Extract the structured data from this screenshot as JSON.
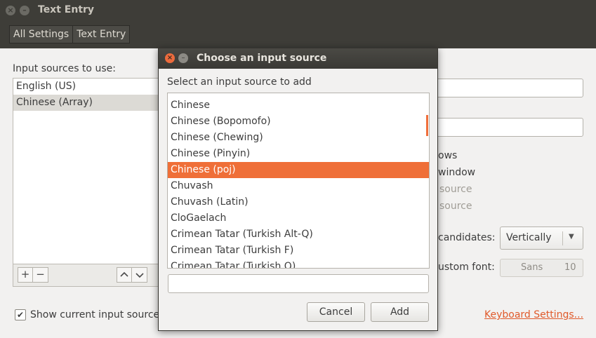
{
  "window": {
    "title": "Text Entry",
    "breadcrumbs": [
      "All Settings",
      "Text Entry"
    ]
  },
  "left_panel": {
    "heading": "Input sources to use:",
    "sources": [
      {
        "label": "English (US)",
        "selected": false
      },
      {
        "label": "Chinese (Array)",
        "selected": true
      }
    ],
    "add_label": "+",
    "remove_label": "−",
    "up_label": "⌃",
    "down_label": "⌄",
    "show_checkbox": {
      "checked": true,
      "label": "Show current input source i"
    }
  },
  "right_panel": {
    "lines": [
      "ows",
      "window",
      "source",
      "source"
    ],
    "candidates_label": "candidates:",
    "candidates_value": "Vertically",
    "custom_font_label": "ustom font:",
    "font_name": "Sans",
    "font_size": "10",
    "keyboard_link": "Keyboard Settings..."
  },
  "dialog": {
    "title": "Choose an input source",
    "prompt": "Select an input source to add",
    "items": [
      "Chinese",
      "Chinese (Bopomofo)",
      "Chinese (Chewing)",
      "Chinese (Pinyin)",
      "Chinese (poj)",
      "Chuvash",
      "Chuvash (Latin)",
      "CloGaelach",
      "Crimean Tatar (Turkish Alt-Q)",
      "Crimean Tatar (Turkish F)",
      "Crimean Tatar (Turkish Q)"
    ],
    "selected_item": "Chinese (poj)",
    "search_value": "",
    "cancel_label": "Cancel",
    "add_label": "Add"
  },
  "colors": {
    "accent": "#ef6f38",
    "link": "#e05a2b",
    "titlebar": "#3e3d38"
  }
}
